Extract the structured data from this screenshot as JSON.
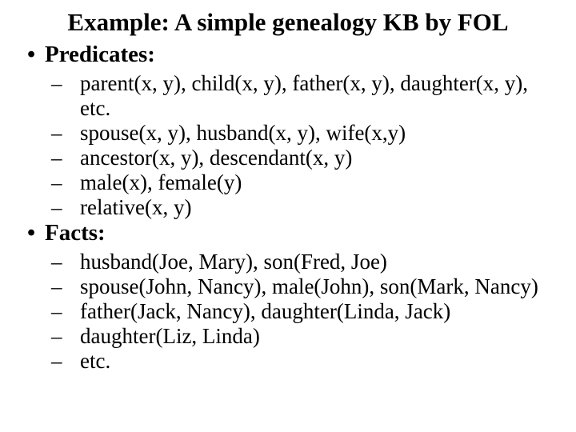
{
  "title": "Example: A simple genealogy KB by FOL",
  "sections": [
    {
      "heading": "Predicates:",
      "items": [
        "parent(x, y), child(x, y), father(x, y), daughter(x, y), etc.",
        "spouse(x, y), husband(x, y), wife(x,y)",
        "ancestor(x, y), descendant(x, y)",
        "male(x), female(y)",
        "relative(x, y)"
      ]
    },
    {
      "heading": "Facts:",
      "items": [
        "husband(Joe, Mary), son(Fred, Joe)",
        "spouse(John, Nancy), male(John), son(Mark, Nancy)",
        "father(Jack, Nancy), daughter(Linda, Jack)",
        "daughter(Liz, Linda)",
        "etc."
      ]
    }
  ]
}
